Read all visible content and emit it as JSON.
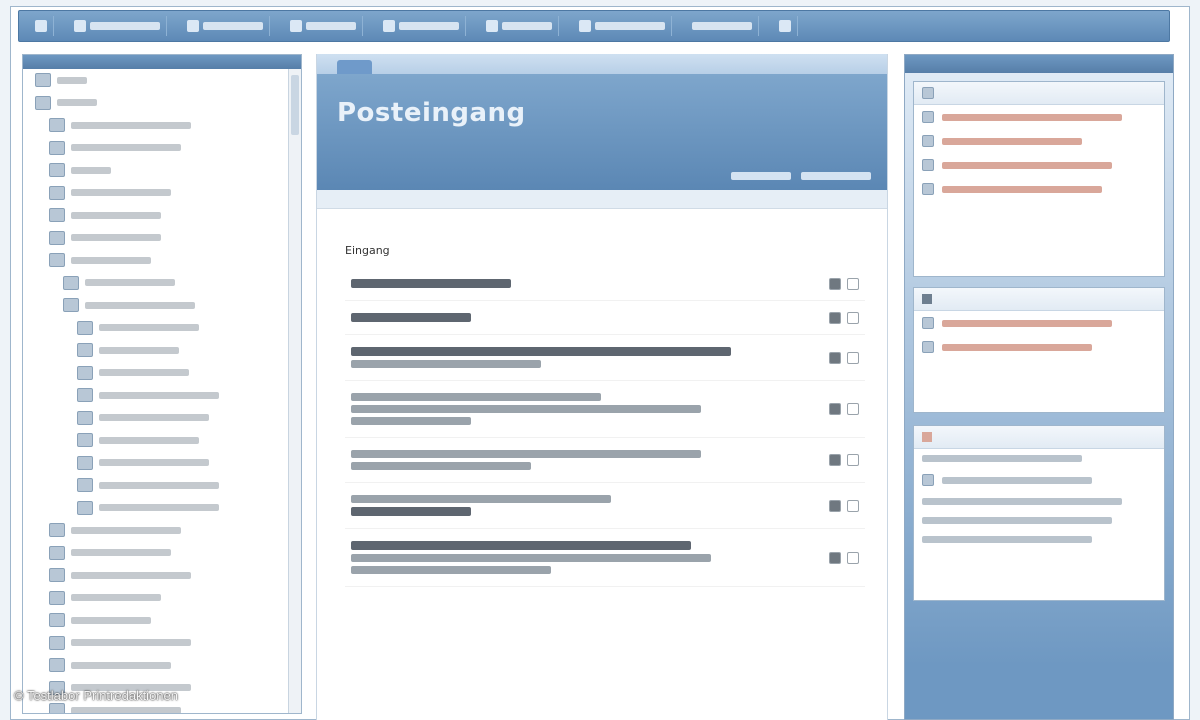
{
  "watermark": "© Testlabor Printredaktionen",
  "banner": {
    "title": "Posteingang"
  },
  "toolbar": {
    "items": 9
  },
  "center": {
    "header": "Eingang"
  },
  "colors": {
    "accent": "#5d89b6",
    "panel": "#6e98c2"
  }
}
